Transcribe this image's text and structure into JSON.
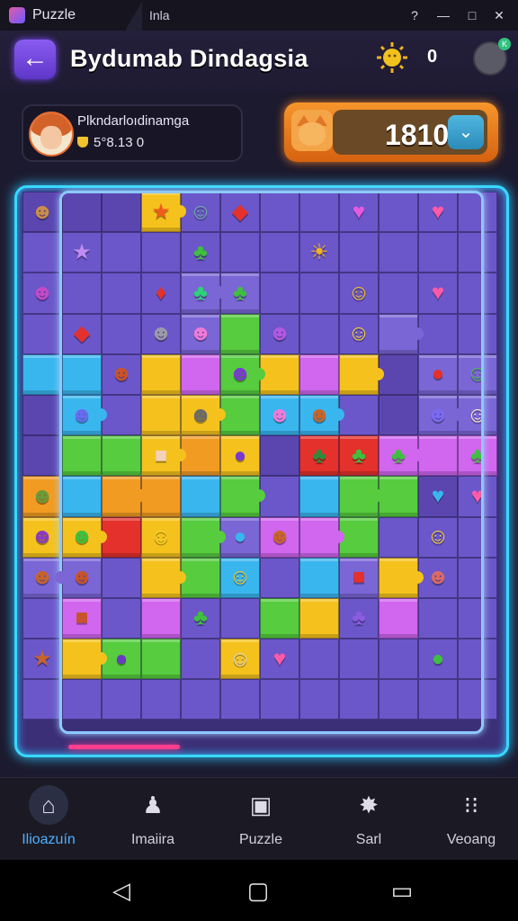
{
  "window": {
    "title": "Puzzle",
    "tab_text": "Inla",
    "controls": [
      "help-icon",
      "minimize-icon",
      "maximize-icon",
      "close-icon"
    ]
  },
  "header": {
    "title": "Bydumab Dindagsia",
    "back_icon": "arrow-left-icon",
    "notification_count": "0",
    "status_badge": "K"
  },
  "profile": {
    "name": "Plkndarloıdinamga",
    "score": "5°8.13 0"
  },
  "score_panel": {
    "value": "1810",
    "dropdown_icon": "chevron-down-icon"
  },
  "board": {
    "colors": {
      "P": "#6b57c9",
      "D": "#5b46b0",
      "L": "#7b66d6",
      "Y": "#f5c21d",
      "G": "#56cc3e",
      "C": "#3ab6ef",
      "M": "#d166ef",
      "R": "#e4312b",
      "O": "#f29b22",
      "B": "#3a88e0"
    },
    "rows": [
      "DDDYPPPPPPPP",
      "PPPPPPPPPPPP",
      "PPPPLLPPPPPP",
      "PPPPLGPPPLPP",
      "CCPYMGYMYDLL",
      "DCPYYGCCPDLL",
      "DGGYOYDRRMMM",
      "OCOOCGPCGGDP",
      "YYRYGLMMGPPP",
      "LLPYGCPCLYPP",
      "PMPMPPGYPMPP",
      "PYGGPYPPPPPP",
      "PPPPPPPPPPPP"
    ],
    "pieces": [
      {
        "r": 0,
        "c": 3,
        "icon": "★",
        "fg": "#f25a1c"
      },
      {
        "r": 0,
        "c": 4,
        "icon": "☺",
        "fg": "#6fb0a0"
      },
      {
        "r": 0,
        "c": 5,
        "icon": "◆",
        "fg": "#e4312b"
      },
      {
        "r": 0,
        "c": 0,
        "icon": "☻",
        "fg": "#c98c4a"
      },
      {
        "r": 0,
        "c": 8,
        "icon": "♥",
        "fg": "#e45ae0"
      },
      {
        "r": 0,
        "c": 10,
        "icon": "♥",
        "fg": "#ff5aa8"
      },
      {
        "r": 1,
        "c": 1,
        "icon": "★",
        "fg": "#c28bf0"
      },
      {
        "r": 1,
        "c": 4,
        "icon": "♣",
        "fg": "#3fbf3f"
      },
      {
        "r": 1,
        "c": 7,
        "icon": "☀",
        "fg": "#f2b21c"
      },
      {
        "r": 2,
        "c": 0,
        "icon": "☻",
        "fg": "#c24ac8"
      },
      {
        "r": 2,
        "c": 3,
        "icon": "♦",
        "fg": "#e4312b"
      },
      {
        "r": 2,
        "c": 4,
        "icon": "♣",
        "fg": "#2fd07a"
      },
      {
        "r": 2,
        "c": 5,
        "icon": "♣",
        "fg": "#3fbf3f"
      },
      {
        "r": 2,
        "c": 8,
        "icon": "☺",
        "fg": "#f2c21c"
      },
      {
        "r": 2,
        "c": 10,
        "icon": "♥",
        "fg": "#ff5aa8"
      },
      {
        "r": 3,
        "c": 1,
        "icon": "◆",
        "fg": "#e4312b"
      },
      {
        "r": 3,
        "c": 3,
        "icon": "☻",
        "fg": "#9a9aa8"
      },
      {
        "r": 3,
        "c": 4,
        "icon": "☻",
        "fg": "#f07ad8"
      },
      {
        "r": 3,
        "c": 6,
        "icon": "☻",
        "fg": "#b05ae0"
      },
      {
        "r": 3,
        "c": 8,
        "icon": "☺",
        "fg": "#f5d22c"
      },
      {
        "r": 4,
        "c": 2,
        "icon": "☻",
        "fg": "#c8542a"
      },
      {
        "r": 4,
        "c": 5,
        "icon": "☻",
        "fg": "#7a3ad0"
      },
      {
        "r": 4,
        "c": 10,
        "icon": "●",
        "fg": "#e4312b"
      },
      {
        "r": 4,
        "c": 11,
        "icon": "☺",
        "fg": "#3fbf3f"
      },
      {
        "r": 5,
        "c": 1,
        "icon": "☻",
        "fg": "#6a6af0"
      },
      {
        "r": 5,
        "c": 4,
        "icon": "☻",
        "fg": "#6a6a6a"
      },
      {
        "r": 5,
        "c": 6,
        "icon": "☻",
        "fg": "#f07ad8"
      },
      {
        "r": 5,
        "c": 7,
        "icon": "☻",
        "fg": "#c8642a"
      },
      {
        "r": 5,
        "c": 10,
        "icon": "☻",
        "fg": "#7a6af0"
      },
      {
        "r": 5,
        "c": 11,
        "icon": "☺",
        "fg": "#fff0c0"
      },
      {
        "r": 6,
        "c": 3,
        "icon": "■",
        "fg": "#f4d2b8"
      },
      {
        "r": 6,
        "c": 5,
        "icon": "●",
        "fg": "#7a3ad0"
      },
      {
        "r": 6,
        "c": 7,
        "icon": "♣",
        "fg": "#2e8b3a"
      },
      {
        "r": 6,
        "c": 8,
        "icon": "♣",
        "fg": "#3fbf3f"
      },
      {
        "r": 6,
        "c": 9,
        "icon": "♣",
        "fg": "#3fbf3f"
      },
      {
        "r": 6,
        "c": 11,
        "icon": "♣",
        "fg": "#3fbf3f"
      },
      {
        "r": 7,
        "c": 0,
        "icon": "☻",
        "fg": "#6a9a3a"
      },
      {
        "r": 7,
        "c": 10,
        "icon": "♥",
        "fg": "#3ab6ef"
      },
      {
        "r": 7,
        "c": 11,
        "icon": "♥",
        "fg": "#ff5aa8"
      },
      {
        "r": 8,
        "c": 0,
        "icon": "☻",
        "fg": "#8a3ac0"
      },
      {
        "r": 8,
        "c": 1,
        "icon": "☻",
        "fg": "#3fbf3f"
      },
      {
        "r": 8,
        "c": 3,
        "icon": "☺",
        "fg": "#f5d22c"
      },
      {
        "r": 8,
        "c": 5,
        "icon": "●",
        "fg": "#3ab6ef"
      },
      {
        "r": 8,
        "c": 6,
        "icon": "☻",
        "fg": "#c8642a"
      },
      {
        "r": 8,
        "c": 10,
        "icon": "☺",
        "fg": "#f5d22c"
      },
      {
        "r": 9,
        "c": 0,
        "icon": "☻",
        "fg": "#c8642a"
      },
      {
        "r": 9,
        "c": 1,
        "icon": "☻",
        "fg": "#c8542a"
      },
      {
        "r": 9,
        "c": 5,
        "icon": "☺",
        "fg": "#f5c21d"
      },
      {
        "r": 9,
        "c": 8,
        "icon": "■",
        "fg": "#e4312b"
      },
      {
        "r": 9,
        "c": 10,
        "icon": "☻",
        "fg": "#d86a6a"
      },
      {
        "r": 10,
        "c": 1,
        "icon": "■",
        "fg": "#c8542a"
      },
      {
        "r": 10,
        "c": 4,
        "icon": "♣",
        "fg": "#3fbf3f"
      },
      {
        "r": 10,
        "c": 8,
        "icon": "♣",
        "fg": "#8a5ce0"
      },
      {
        "r": 11,
        "c": 0,
        "icon": "★",
        "fg": "#c8642a"
      },
      {
        "r": 11,
        "c": 2,
        "icon": "●",
        "fg": "#6a3ac0"
      },
      {
        "r": 11,
        "c": 5,
        "icon": "☺",
        "fg": "#d8d2c8"
      },
      {
        "r": 11,
        "c": 6,
        "icon": "♥",
        "fg": "#ff5aa8"
      },
      {
        "r": 11,
        "c": 10,
        "icon": "●",
        "fg": "#3fbf3f"
      }
    ]
  },
  "nav": {
    "items": [
      {
        "label": "Ilioazuín",
        "icon": "home-icon",
        "active": true
      },
      {
        "label": "Imaiira",
        "icon": "profile-icon",
        "active": false
      },
      {
        "label": "Puzzle",
        "icon": "puzzle-icon",
        "active": false
      },
      {
        "label": "Sarl",
        "icon": "star-icon",
        "active": false
      },
      {
        "label": "Veoang",
        "icon": "grid-icon",
        "active": false
      }
    ]
  },
  "system_nav": [
    "back-icon",
    "home-icon",
    "recents-icon"
  ]
}
